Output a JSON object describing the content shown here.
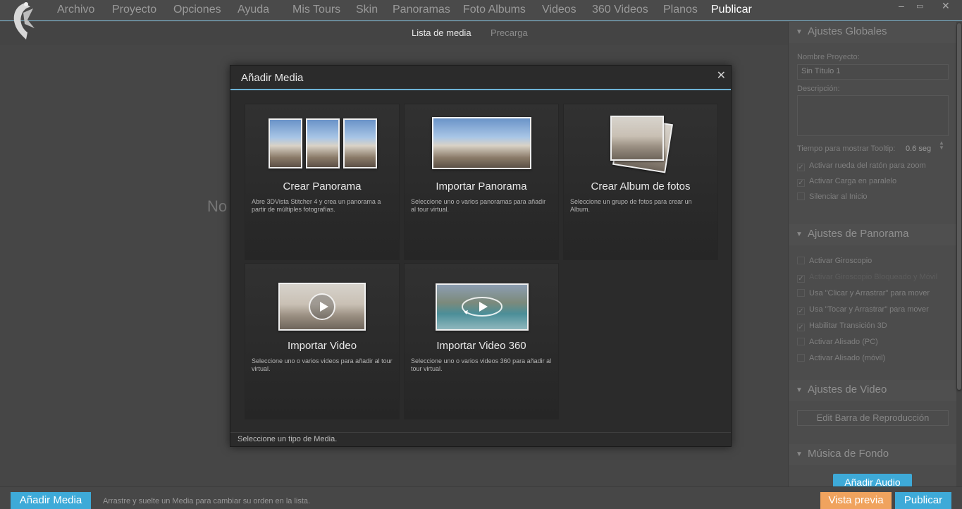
{
  "menubar": {
    "items": [
      "Archivo",
      "Proyecto",
      "Opciones",
      "Ayuda"
    ],
    "tabs": [
      "Mis Tours",
      "Skin",
      "Panoramas",
      "Foto Albums",
      "Videos",
      "360 Videos",
      "Planos",
      "Publicar"
    ],
    "active_tab": "Publicar",
    "window_buttons": [
      "–",
      "▭",
      "✕"
    ]
  },
  "subtabs": [
    "Lista de media",
    "Precarga"
  ],
  "main": {
    "empty_text": "No"
  },
  "dialog": {
    "title": "Añadir Media",
    "close": "✕",
    "cards": [
      {
        "title": "Crear Panorama",
        "desc": "Abre 3DVista Stitcher 4 y crea un panorama a partir de múltiples fotografías.",
        "icon": "three-photos-icon"
      },
      {
        "title": "Importar Panorama",
        "desc": "Seleccione uno o varios panoramas para añadir al tour virtual.",
        "icon": "panorama-photo-icon"
      },
      {
        "title": "Crear Album de fotos",
        "desc": "Seleccione un grupo de fotos para crear un Album.",
        "icon": "photo-stack-icon"
      },
      {
        "title": "Importar Video",
        "desc": "Seleccione uno o varios videos para añadir al tour virtual.",
        "icon": "video-play-icon"
      },
      {
        "title": "Importar Video 360",
        "desc": "Seleccione uno o varios videos 360 para añadir al tour virtual.",
        "icon": "video-360-icon"
      }
    ],
    "status": "Seleccione un tipo de Media."
  },
  "panel": {
    "global": {
      "title": "Ajustes Globales",
      "project_label": "Nombre Proyecto:",
      "project_value": "Sin Título 1",
      "desc_label": "Descripción:",
      "tooltip_label": "Tiempo para mostrar Tooltip:",
      "tooltip_value": "0.6 seg",
      "checks": [
        {
          "label": "Activar rueda del ratón para zoom",
          "checked": true
        },
        {
          "label": "Activar Carga en paralelo",
          "checked": true
        },
        {
          "label": "Silenciar al Inicio",
          "checked": false
        }
      ]
    },
    "panorama": {
      "title": "Ajustes de Panorama",
      "checks": [
        {
          "label": "Activar Giroscopio",
          "checked": false
        },
        {
          "label": "Activar Giroscopio Bloqueado y Móvil",
          "checked": true,
          "disabled": true
        },
        {
          "label": "Usa \"Clicar y Arrastrar\" para mover",
          "checked": false
        },
        {
          "label": "Usa \"Tocar y Arrastrar\" para mover",
          "checked": true
        },
        {
          "label": "Habilitar Transición 3D",
          "checked": true
        },
        {
          "label": "Activar Alisado (PC)",
          "checked": false
        },
        {
          "label": "Activar Alisado (móvil)",
          "checked": false
        }
      ]
    },
    "video": {
      "title": "Ajustes de Video",
      "button": "Edit Barra de Reproducción"
    },
    "music": {
      "title": "Música de Fondo",
      "button": "Añadir Audio"
    }
  },
  "bottombar": {
    "add_media": "Añadir Media",
    "hint": "Arrastre y suelte un Media para cambiar su orden en la lista.",
    "preview": "Vista previa",
    "publish": "Publicar"
  },
  "colors": {
    "accent_blue": "#3eaad8",
    "accent_orange": "#f0a35e",
    "divider_blue": "#6fb3d6"
  }
}
